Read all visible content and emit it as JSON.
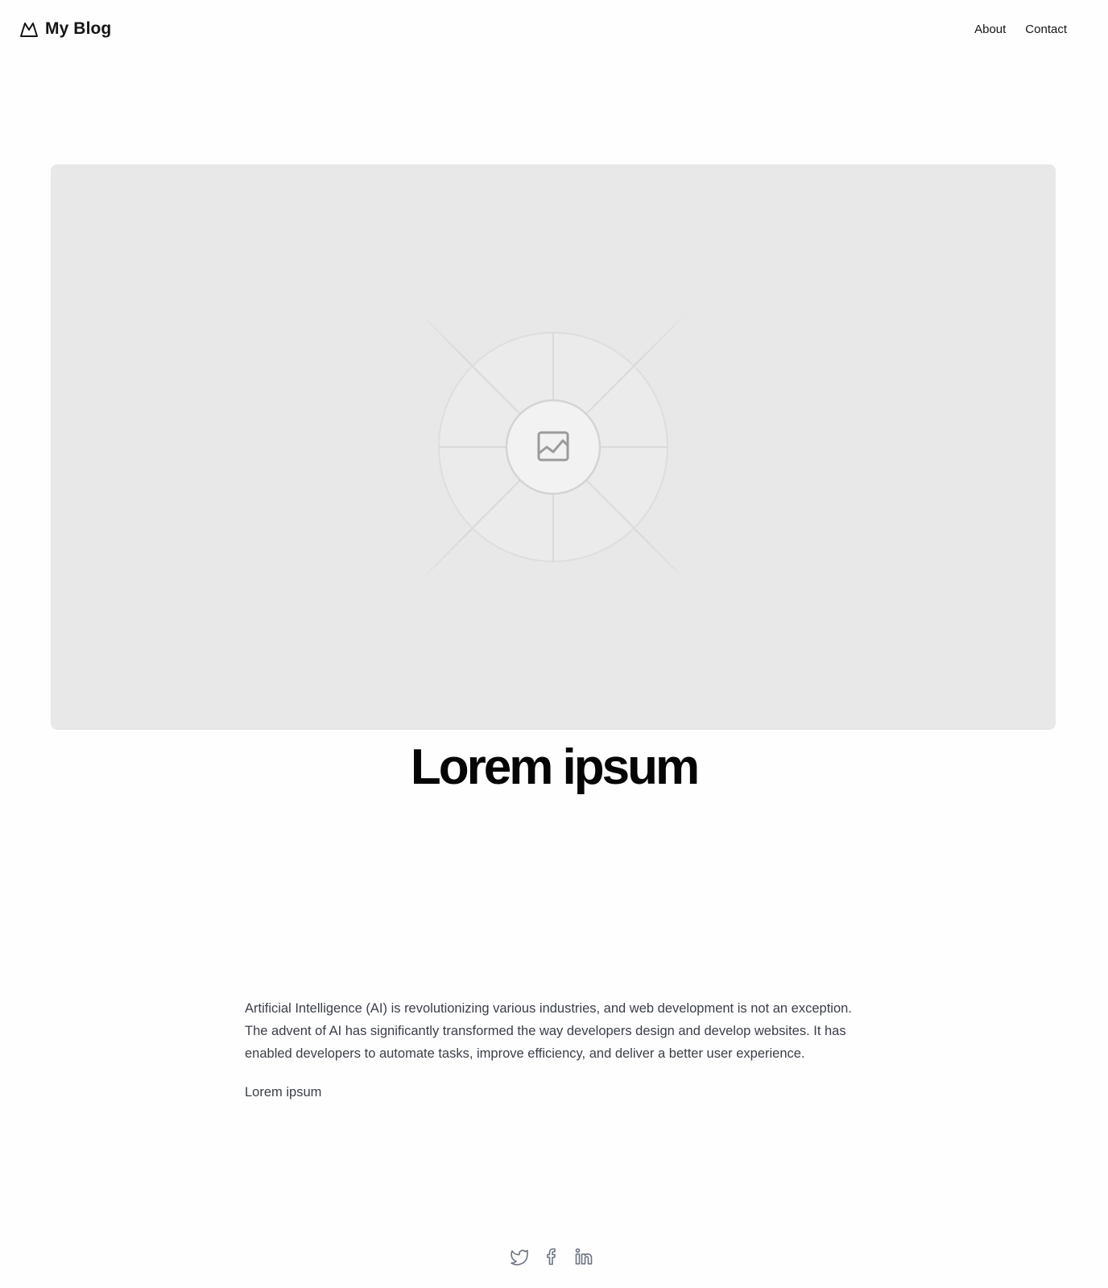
{
  "header": {
    "brand": "My Blog",
    "logo_icon": "mountain-icon",
    "nav": [
      {
        "label": "About"
      },
      {
        "label": "Contact"
      }
    ]
  },
  "hero": {
    "image_icon": "image-placeholder-icon",
    "background_color": "#e8e8e8"
  },
  "post": {
    "title": "Lorem ipsum",
    "paragraphs": [
      "Artificial Intelligence (AI) is revolutionizing various industries, and web development is not an exception. The advent of AI has significantly transformed the way developers design and develop websites. It has enabled developers to automate tasks, improve efficiency, and deliver a better user experience.",
      "Lorem ipsum"
    ]
  },
  "footer": {
    "socials": [
      {
        "icon": "twitter-icon"
      },
      {
        "icon": "facebook-icon"
      },
      {
        "icon": "linkedin-icon"
      }
    ]
  },
  "colors": {
    "text_primary": "#151515",
    "text_body": "#3b3f47",
    "icon_gray": "#6b7280"
  }
}
